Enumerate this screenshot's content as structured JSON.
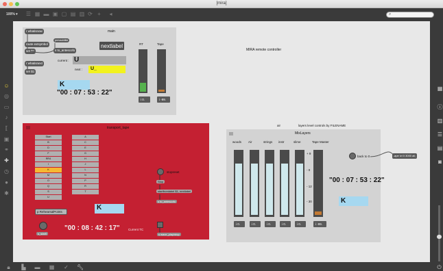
{
  "window": {
    "title": "[mira]"
  },
  "toolbar": {
    "zoom": "100% ▾"
  },
  "main": {
    "title": "main",
    "obj_whatisnow": "r whatisnow",
    "obj_route": "route extsymbol",
    "obj_prevsubtitle": "prevsubtitle",
    "obj_set1a": "set $1",
    "obj_toantescofo": "s to_antescofo",
    "obj_nextlabel": "nextlabel",
    "obj_whatisnext": "r whatisnext",
    "obj_set1b": "set $1",
    "current_label": "current :",
    "current_value": "U",
    "next_label": "next :",
    "next_value": "U_",
    "k_value": "K",
    "timecode": "\"00 : 07 : 53 : 22\"",
    "rt_label": "RT",
    "tape_label": "Tape",
    "rt_number": "i 0.",
    "tape_number": "i -99.",
    "rt_level": 0.22,
    "tape_level": 0.05
  },
  "mira_label": "MIRA remote controller",
  "transport": {
    "title": "transport_tape",
    "rows_left": [
      "Start",
      "B",
      "D",
      "F",
      "RR4",
      "I",
      "K",
      "M",
      "O",
      "Q",
      "S",
      "U"
    ],
    "rows_right": [
      "A",
      "C",
      "E",
      "G",
      "H",
      "J",
      "L",
      "N",
      "P",
      "R",
      "T"
    ],
    "highlighted": "K",
    "obj_rehearsal": "p RehearsalPoints",
    "k_value": "K",
    "stopreset_label": "stopreset",
    "msg_stop": "Stop",
    "msg_startfromlabel": "startfromlabel $1, nextlabel",
    "msg_toantescofo": "s to_antescofo",
    "timecode": "\"00 : 08 : 42 : 17\"",
    "current_tc": "Current TC",
    "msg_wave": "s wave_play/stop",
    "obj_startl": "s_startl"
  },
  "air_label": "air",
  "layers_caption": "layers level controls by FILENAME",
  "mixlayers": {
    "title": "MixLayers",
    "channels": [
      "woods",
      "Air",
      "strings",
      "instr",
      "slime",
      "Tape Master"
    ],
    "scale": [
      "+ 9",
      "- 0",
      "- 12",
      "- 30"
    ],
    "numbers": [
      "i 0.",
      "i 0.",
      "i 0.",
      "i 0.",
      "i 0.",
      "i -99."
    ],
    "back_to_0": "back to 0",
    "timecode": "\"00 : 07 : 53 : 22\"",
    "k_value": "K",
    "levels": [
      0.82,
      0.82,
      0.82,
      0.82,
      0.82,
      0.05
    ]
  },
  "tape_message": "tape lvl 0 3000 all;",
  "colors": {
    "accent_red": "#c42032",
    "k_box": "#a6d8f0",
    "next_yellow": "#f2f21e",
    "highlight": "#f6b732",
    "rt_green": "#56b24e",
    "slider_light": "#cfe8ec"
  }
}
